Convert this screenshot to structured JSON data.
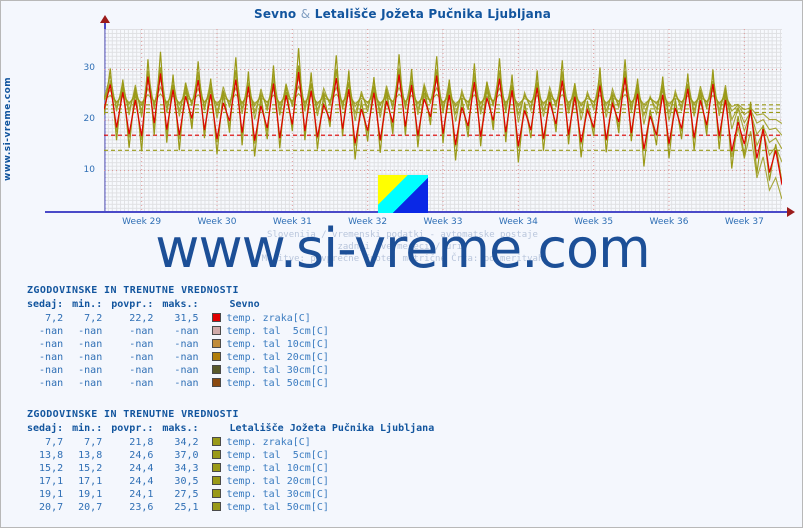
{
  "title": {
    "left": "Sevno",
    "amp": "&",
    "right": "Letališče Jožeta Pučnika Ljubljana",
    "full": "Sevno & Letališče Jožeta Pučnika Ljubljana"
  },
  "side_label": "www.si-vreme.com",
  "watermark": "www.si-vreme.com",
  "caption": {
    "line1": "Slovenija / vremenski podatki - avtomatske postaje",
    "line2": "zadnji dve meseci / uri.",
    "line3": "Meritve: povprečne  Enote: metrične  Črta: po meritvah"
  },
  "colors": {
    "accent_blue": "#12559e",
    "text_blue": "#2f6fb5",
    "axis": "#4a4ac8",
    "arrow": "#9b1b1b",
    "grid_major": "#e09a9a",
    "grid_minor": "#cfcfcf",
    "background": "#f4f7fd",
    "plot_background": "#fbfcfe",
    "series_air_sevno": "#e00000",
    "series_air_airport": "#9a9a18",
    "soil_5cm": "#d0aaa8",
    "soil_10cm": "#c08c3a",
    "soil_20cm": "#b07d0a",
    "soil_30cm": "#5a5a2a",
    "soil_50cm": "#8a4a10",
    "airport_series": "#9a9a18"
  },
  "chart_data": {
    "type": "line",
    "title": "Sevno & Letališče Jožeta Pučnika Ljubljana",
    "xlabel": "",
    "ylabel": "",
    "ylim": [
      2,
      38
    ],
    "yticks": [
      10,
      20,
      30
    ],
    "ytick_labels": [
      "10",
      "20",
      "30"
    ],
    "xticks": [
      "Week 29",
      "Week 30",
      "Week 31",
      "Week 32",
      "Week 33",
      "Week 34",
      "Week 35",
      "Week 36",
      "Week 37"
    ],
    "grid": true,
    "legend_position": "below-table",
    "reference_lines": [
      {
        "name": "sevno-air-current",
        "value": 17.0,
        "color": "#e00000",
        "style": "dashed"
      },
      {
        "name": "airport-air-current",
        "value": 14.0,
        "color": "#9a9a18",
        "style": "dashed"
      },
      {
        "name": "airport-soil-5cm-current",
        "value": 21.5,
        "color": "#9a9a18",
        "style": "dashed"
      },
      {
        "name": "airport-soil-10cm-current",
        "value": 22.2,
        "color": "#9a9a18",
        "style": "dashed"
      },
      {
        "name": "airport-soil-20cm-current",
        "value": 23.0,
        "color": "#9a9a18",
        "style": "dashed"
      }
    ],
    "series": [
      {
        "name": "Sevno temp. zraka[C]",
        "color": "#e00000",
        "now": 7.2,
        "min": 7.2,
        "avg": 22.2,
        "max": 31.5,
        "values": [
          22.1,
          27.0,
          18.5,
          25.5,
          17.2,
          24.0,
          16.8,
          28.6,
          19.4,
          29.2,
          18.1,
          26.0,
          17.0,
          24.7,
          20.3,
          27.9,
          18.0,
          25.1,
          16.2,
          23.4,
          19.8,
          28.0,
          17.5,
          26.6,
          15.9,
          22.8,
          18.4,
          27.2,
          16.4,
          24.9,
          19.1,
          29.5,
          17.8,
          25.8,
          16.6,
          23.0,
          20.0,
          28.3,
          18.2,
          26.1,
          15.4,
          22.2,
          17.9,
          25.4,
          16.0,
          23.8,
          19.5,
          29.0,
          18.7,
          26.9,
          16.9,
          24.2,
          20.6,
          28.8,
          17.3,
          25.0,
          15.1,
          22.5,
          18.8,
          27.5,
          16.7,
          24.4,
          19.9,
          28.2,
          17.6,
          25.9,
          14.8,
          21.9,
          18.0,
          26.4,
          16.3,
          23.6,
          19.2,
          27.8,
          17.1,
          24.6,
          15.6,
          22.0,
          18.5,
          26.8,
          16.1,
          23.2,
          19.6,
          28.4,
          17.4,
          25.2,
          14.2,
          20.8,
          17.0,
          25.0,
          15.3,
          22.4,
          18.3,
          26.2,
          16.5,
          23.9,
          19.0,
          27.1,
          16.8,
          24.0,
          13.8,
          19.6,
          15.2,
          22.0,
          12.4,
          18.2,
          9.6,
          14.0,
          7.2
        ]
      },
      {
        "name": "Letališče temp. zraka[C]",
        "color": "#9a9a18",
        "now": 7.7,
        "min": 7.7,
        "avg": 21.8,
        "max": 34.2,
        "values": [
          21.0,
          30.2,
          16.0,
          28.0,
          14.5,
          26.5,
          13.8,
          32.0,
          17.0,
          33.5,
          15.5,
          29.0,
          14.0,
          27.4,
          18.2,
          31.6,
          16.4,
          28.2,
          13.2,
          25.8,
          17.5,
          32.4,
          15.0,
          29.6,
          12.8,
          24.9,
          16.2,
          30.8,
          14.4,
          27.0,
          17.8,
          34.2,
          16.0,
          29.4,
          14.2,
          25.2,
          18.6,
          32.8,
          16.8,
          29.8,
          12.2,
          24.0,
          15.8,
          28.5,
          13.5,
          26.2,
          17.2,
          33.0,
          17.0,
          30.1,
          14.6,
          26.8,
          19.0,
          32.6,
          15.4,
          28.0,
          12.0,
          24.4,
          16.6,
          31.2,
          14.8,
          27.6,
          18.0,
          32.2,
          15.6,
          29.0,
          11.6,
          23.5,
          16.4,
          29.8,
          13.9,
          25.6,
          17.6,
          31.8,
          15.2,
          27.2,
          12.6,
          23.8,
          16.8,
          30.4,
          13.6,
          25.0,
          17.4,
          32.0,
          15.8,
          28.2,
          10.8,
          22.0,
          15.0,
          28.6,
          12.4,
          24.2,
          16.2,
          29.2,
          14.0,
          26.0,
          17.0,
          30.0,
          14.2,
          26.4,
          10.4,
          20.8,
          12.8,
          23.6,
          9.4,
          19.0,
          8.0,
          15.2,
          7.7
        ]
      },
      {
        "name": "Letališče temp. tal 5cm[C]",
        "color": "#9a9a18",
        "now": 13.8,
        "min": 13.8,
        "avg": 24.6,
        "max": 37.0
      },
      {
        "name": "Letališče temp. tal 10cm[C]",
        "color": "#9a9a18",
        "now": 15.2,
        "min": 15.2,
        "avg": 24.4,
        "max": 34.3
      },
      {
        "name": "Letališče temp. tal 20cm[C]",
        "color": "#9a9a18",
        "now": 17.1,
        "min": 17.1,
        "avg": 24.4,
        "max": 30.5
      },
      {
        "name": "Letališče temp. tal 30cm[C]",
        "color": "#9a9a18",
        "now": 19.1,
        "min": 19.1,
        "avg": 24.1,
        "max": 27.5
      },
      {
        "name": "Letališče temp. tal 50cm[C]",
        "color": "#9a9a18",
        "now": 20.7,
        "min": 20.7,
        "avg": 23.6,
        "max": 25.1
      }
    ]
  },
  "tables": [
    {
      "heading": "ZGODOVINSKE IN TRENUTNE VREDNOSTI",
      "columns": [
        "sedaj:",
        "min.:",
        "povpr.:",
        "maks.:"
      ],
      "station": "Sevno",
      "rows": [
        {
          "now": "7,2",
          "min": "7,2",
          "avg": "22,2",
          "max": "31,5",
          "color": "#e00000",
          "label": "temp. zraka[C]"
        },
        {
          "now": "-nan",
          "min": "-nan",
          "avg": "-nan",
          "max": "-nan",
          "color": "#d0aaa8",
          "label": "temp. tal  5cm[C]"
        },
        {
          "now": "-nan",
          "min": "-nan",
          "avg": "-nan",
          "max": "-nan",
          "color": "#c08c3a",
          "label": "temp. tal 10cm[C]"
        },
        {
          "now": "-nan",
          "min": "-nan",
          "avg": "-nan",
          "max": "-nan",
          "color": "#b07d0a",
          "label": "temp. tal 20cm[C]"
        },
        {
          "now": "-nan",
          "min": "-nan",
          "avg": "-nan",
          "max": "-nan",
          "color": "#5a5a2a",
          "label": "temp. tal 30cm[C]"
        },
        {
          "now": "-nan",
          "min": "-nan",
          "avg": "-nan",
          "max": "-nan",
          "color": "#8a4a10",
          "label": "temp. tal 50cm[C]"
        }
      ]
    },
    {
      "heading": "ZGODOVINSKE IN TRENUTNE VREDNOSTI",
      "columns": [
        "sedaj:",
        "min.:",
        "povpr.:",
        "maks.:"
      ],
      "station": "Letališče Jožeta Pučnika Ljubljana",
      "rows": [
        {
          "now": "7,7",
          "min": "7,7",
          "avg": "21,8",
          "max": "34,2",
          "color": "#9a9a18",
          "label": "temp. zraka[C]"
        },
        {
          "now": "13,8",
          "min": "13,8",
          "avg": "24,6",
          "max": "37,0",
          "color": "#9a9a18",
          "label": "temp. tal  5cm[C]"
        },
        {
          "now": "15,2",
          "min": "15,2",
          "avg": "24,4",
          "max": "34,3",
          "color": "#9a9a18",
          "label": "temp. tal 10cm[C]"
        },
        {
          "now": "17,1",
          "min": "17,1",
          "avg": "24,4",
          "max": "30,5",
          "color": "#9a9a18",
          "label": "temp. tal 20cm[C]"
        },
        {
          "now": "19,1",
          "min": "19,1",
          "avg": "24,1",
          "max": "27,5",
          "color": "#9a9a18",
          "label": "temp. tal 30cm[C]"
        },
        {
          "now": "20,7",
          "min": "20,7",
          "avg": "23,6",
          "max": "25,1",
          "color": "#9a9a18",
          "label": "temp. tal 50cm[C]"
        }
      ]
    }
  ]
}
